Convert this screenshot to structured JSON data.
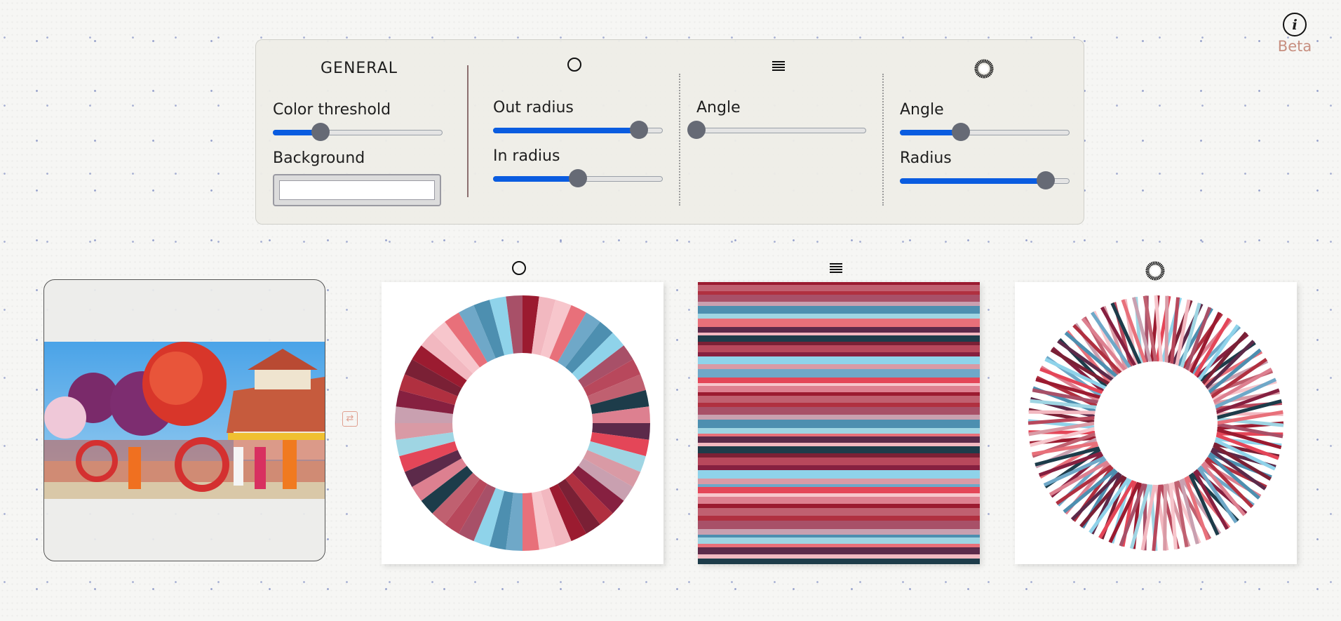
{
  "header": {
    "info_icon": "info-icon",
    "info_glyph": "i",
    "beta_label": "Beta"
  },
  "general": {
    "title": "GENERAL",
    "color_threshold_label": "Color threshold",
    "color_threshold_value": 0.28,
    "background_label": "Background",
    "background_value": ""
  },
  "circle_section": {
    "icon": "circle-icon",
    "out_radius_label": "Out radius",
    "out_radius_value": 0.86,
    "in_radius_label": "In radius",
    "in_radius_value": 0.5
  },
  "lines_section": {
    "icon": "lines-icon",
    "angle_label": "Angle",
    "angle_value": 0.0
  },
  "spiral_section": {
    "icon": "spiral-icon",
    "angle_label": "Angle",
    "angle_value": 0.36,
    "radius_label": "Radius",
    "radius_value": 0.86
  },
  "outputs": {
    "swap_icon": "swap-icon",
    "palette": [
      "#9b1b30",
      "#e8707a",
      "#8fd3ea",
      "#c06070",
      "#5c2a4a",
      "#d99aa5",
      "#b03040",
      "#f2b8c0",
      "#6fa8c8",
      "#a85068",
      "#1d3c4a",
      "#e44658",
      "#c9a0b0",
      "#7a2035",
      "#f7c6cc",
      "#4d8fb0",
      "#b8485c",
      "#dd8090",
      "#9fd5e3",
      "#862040"
    ]
  },
  "colors": {
    "accent": "#0a5ce0",
    "thumb": "#666a75",
    "beta": "#c78f80"
  }
}
